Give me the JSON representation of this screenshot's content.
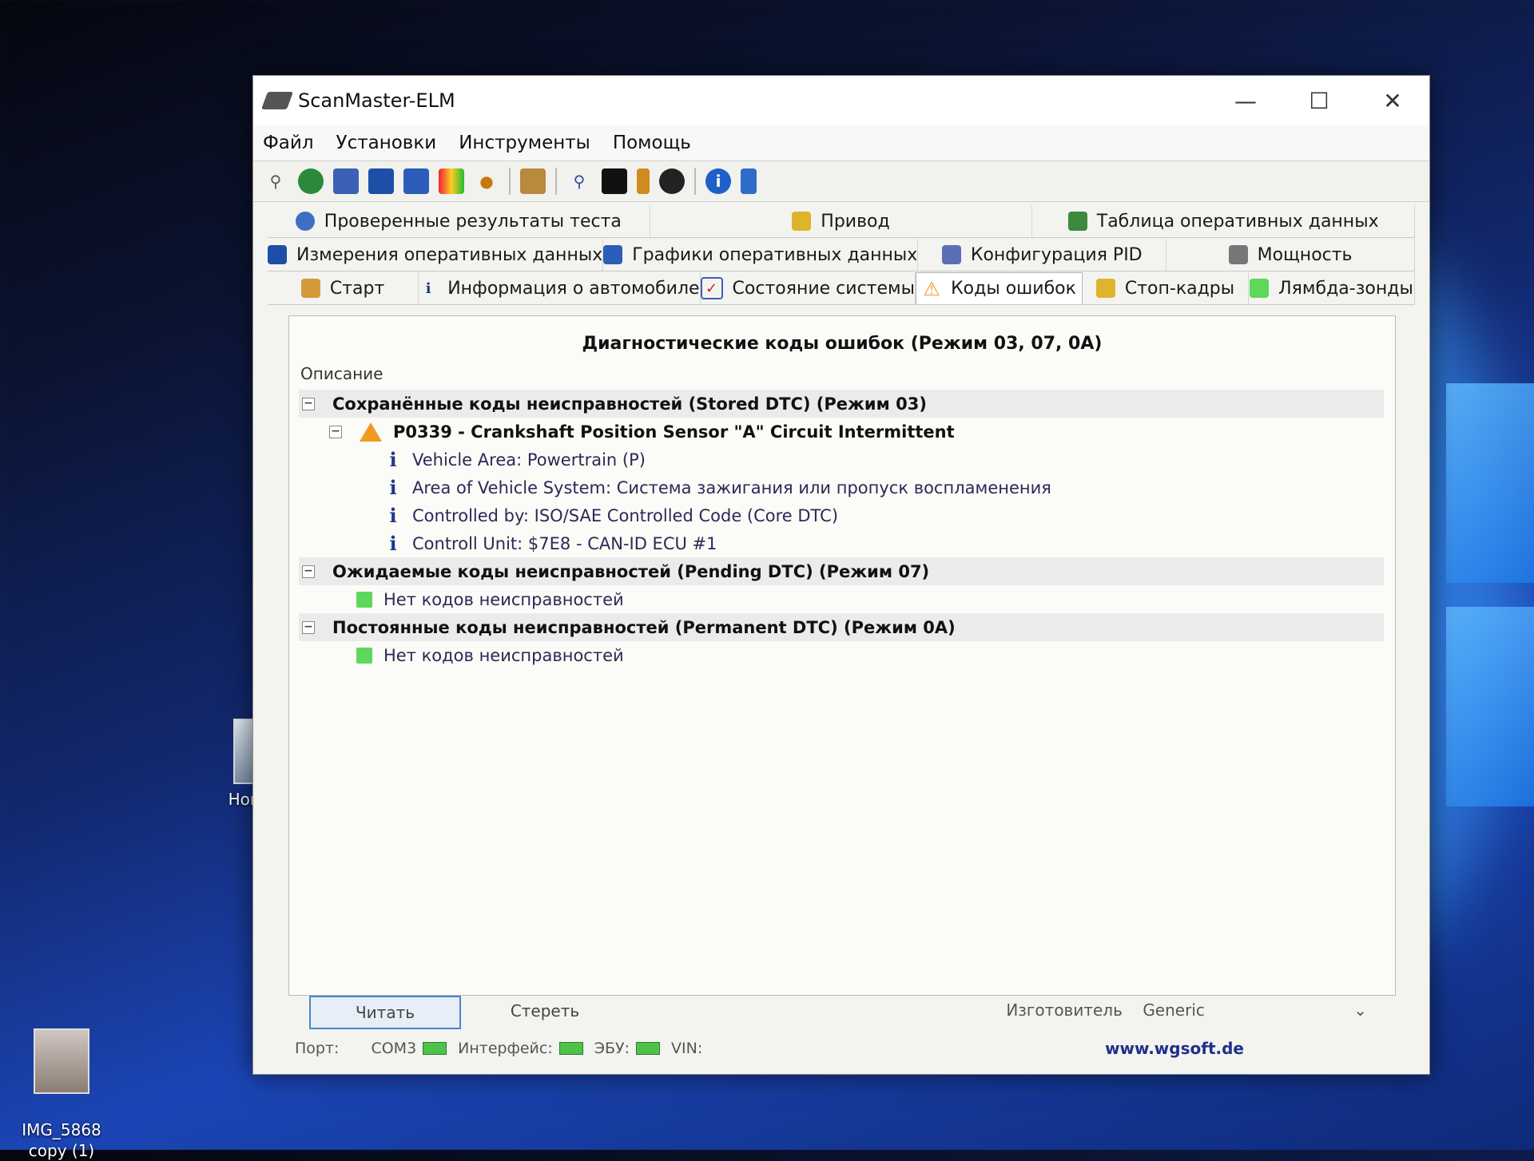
{
  "desktop": {
    "icons": [
      {
        "label": "Новая п"
      },
      {
        "label": "IMG_5868\ncopy (1)"
      }
    ]
  },
  "window": {
    "title": "ScanMaster-ELM",
    "controls": [
      "minimize-icon",
      "maximize-icon",
      "close-icon"
    ]
  },
  "menu": [
    "Файл",
    "Установки",
    "Инструменты",
    "Помощь"
  ],
  "toolbar": {
    "icons": [
      "connect-icon",
      "globe-icon",
      "document-icon",
      "grid-icon",
      "bar-chart-icon",
      "map-icon",
      "user-icon",
      "clipboard-icon",
      "magnifier-icon",
      "terminal-icon",
      "battery-icon",
      "gauge-icon",
      "info-icon",
      "exit-icon"
    ]
  },
  "tabs": {
    "row1": [
      {
        "label": "Проверенные результаты теста",
        "icon": "gear-icon"
      },
      {
        "label": "Привод",
        "icon": "engine-icon"
      },
      {
        "label": "Таблица оперативных данных",
        "icon": "table-icon"
      }
    ],
    "row2": [
      {
        "label": "Измерения оперативных данных",
        "icon": "grid-icon"
      },
      {
        "label": "Графики оперативных данных",
        "icon": "chart-icon"
      },
      {
        "label": "Конфигурация PID",
        "icon": "config-icon"
      },
      {
        "label": "Мощность",
        "icon": "power-icon"
      }
    ],
    "row3": [
      {
        "label": "Старт",
        "icon": "home-icon"
      },
      {
        "label": "Информация о автомобиле",
        "icon": "info-icon"
      },
      {
        "label": "Состояние системы",
        "icon": "checklist-icon"
      },
      {
        "label": "Коды ошибок",
        "icon": "warning-icon",
        "active": true
      },
      {
        "label": "Стоп-кадры",
        "icon": "engine-icon"
      },
      {
        "label": "Лямбда-зонды",
        "icon": "sensor-icon"
      }
    ]
  },
  "panel": {
    "title": "Диагностические коды ошибок (Режим 03, 07, 0A)",
    "column_header": "Описание",
    "stored": {
      "label": "Сохранённые коды неисправностей (Stored DTC) (Режим 03)",
      "dtc": {
        "label": "P0339 - Crankshaft Position Sensor \"A\" Circuit Intermittent",
        "details": [
          "Vehicle Area: Powertrain (P)",
          "Area of Vehicle System: Система зажигания или пропуск воспламенения",
          "Controlled by: ISO/SAE Controlled Code (Core DTC)",
          "Controll Unit: $7E8 - CAN-ID ECU #1"
        ]
      }
    },
    "pending": {
      "label": "Ожидаемые коды неисправностей (Pending DTC) (Режим 07)",
      "child": "Нет кодов неисправностей"
    },
    "permanent": {
      "label": "Постоянные коды неисправностей (Permanent DTC) (Режим 0A)",
      "child": "Нет кодов неисправностей"
    }
  },
  "buttons": {
    "read": "Читать",
    "clear": "Стереть",
    "manufacturer_label": "Изготовитель",
    "manufacturer_value": "Generic"
  },
  "status": {
    "port_label": "Порт:",
    "port_value": "COM3",
    "interface_label": "Интерфейс:",
    "ecu_label": "ЭБУ:",
    "vin_label": "VIN:",
    "website": "www.wgsoft.de"
  },
  "colors": {
    "accent": "#4a86c8",
    "warning": "#f19a20",
    "ok": "#5dd85b",
    "info": "#1f3a8c",
    "link": "#1f2f8a"
  }
}
